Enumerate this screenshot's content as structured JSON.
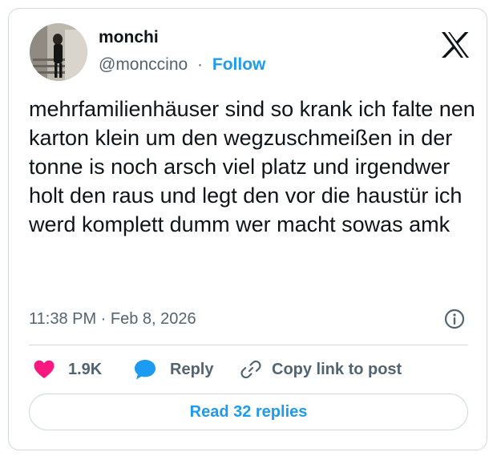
{
  "author": {
    "name": "monchi",
    "handle": "@monccino",
    "separator": "·",
    "follow_label": "Follow"
  },
  "icons": {
    "logo": "x-logo-icon",
    "info": "info-icon",
    "like": "heart-icon",
    "reply": "speech-bubble-icon",
    "copy_link": "link-icon"
  },
  "tweet": {
    "text": "mehrfamilienhäuser sind so krank ich falte nen karton klein um den wegzuschmeißen in der tonne is noch arsch viel platz und irgendwer holt den raus und legt den vor die haustür ich werd komplett dumm wer macht sowas amk",
    "timestamp": "11:38 PM · Feb 8, 2026"
  },
  "actions": {
    "likes_count": "1.9K",
    "reply_label": "Reply",
    "copy_link_label": "Copy link to post"
  },
  "footer": {
    "read_replies_label": "Read 32 replies"
  },
  "colors": {
    "accent": "#1d9bf0",
    "like": "#f91880",
    "muted_text": "#536471",
    "border": "#cfd9de"
  }
}
